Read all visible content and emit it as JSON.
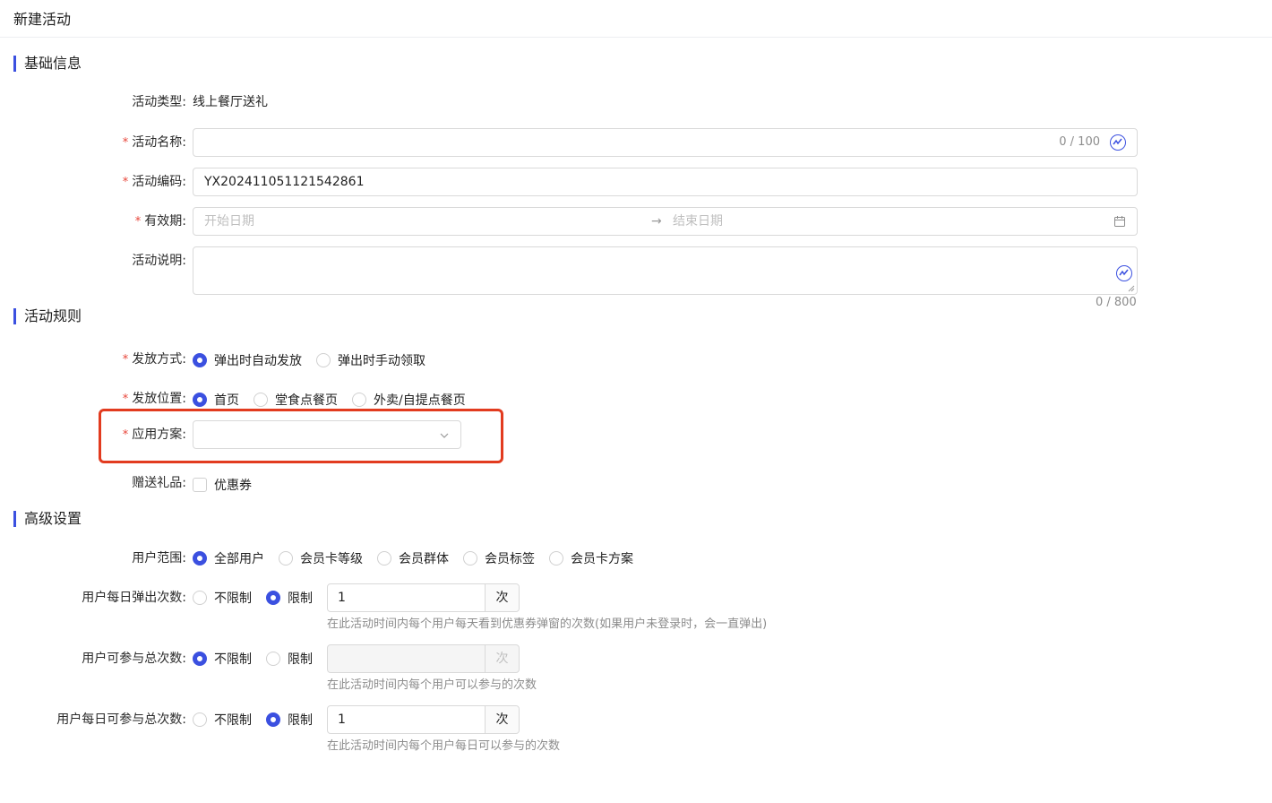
{
  "page": {
    "title": "新建活动"
  },
  "sections": {
    "basic": "基础信息",
    "rules": "活动规则",
    "advanced": "高级设置"
  },
  "basic": {
    "type_label": "活动类型",
    "type_value": "线上餐厅送礼",
    "name_label": "活动名称",
    "name_value": "",
    "name_counter": "0 / 100",
    "code_label": "活动编码",
    "code_value": "YX202411051121542861",
    "validity_label": "有效期",
    "start_placeholder": "开始日期",
    "end_placeholder": "结束日期",
    "desc_label": "活动说明",
    "desc_counter": "0 / 800"
  },
  "rules": {
    "issue_method_label": "发放方式",
    "issue_method_options": [
      "弹出时自动发放",
      "弹出时手动领取"
    ],
    "issue_method_selected": 0,
    "issue_position_label": "发放位置",
    "issue_position_options": [
      "首页",
      "堂食点餐页",
      "外卖/自提点餐页"
    ],
    "issue_position_selected": 0,
    "scheme_label": "应用方案",
    "scheme_value": "",
    "gift_label": "赠送礼品",
    "gift_option": "优惠券",
    "gift_checked": false
  },
  "advanced": {
    "user_scope_label": "用户范围",
    "user_scope_options": [
      "全部用户",
      "会员卡等级",
      "会员群体",
      "会员标签",
      "会员卡方案"
    ],
    "user_scope_selected": 0,
    "daily_popup_label": "用户每日弹出次数",
    "daily_popup_unlimited": "不限制",
    "daily_popup_limited": "限制",
    "daily_popup_selected": "限制",
    "daily_popup_value": "1",
    "daily_popup_unit": "次",
    "daily_popup_hint": "在此活动时间内每个用户每天看到优惠券弹窗的次数(如果用户未登录时，会一直弹出)",
    "total_label": "用户可参与总次数",
    "total_unlimited": "不限制",
    "total_limited": "限制",
    "total_selected": "不限制",
    "total_value": "",
    "total_unit": "次",
    "total_hint": "在此活动时间内每个用户可以参与的次数",
    "daily_total_label": "用户每日可参与总次数",
    "daily_total_unlimited": "不限制",
    "daily_total_limited": "限制",
    "daily_total_selected": "限制",
    "daily_total_value": "1",
    "daily_total_unit": "次",
    "daily_total_hint": "在此活动时间内每个用户每日可以参与的次数"
  },
  "colors": {
    "accent": "#3b50e0",
    "required": "#e8463a",
    "highlight": "#e23b1f"
  }
}
